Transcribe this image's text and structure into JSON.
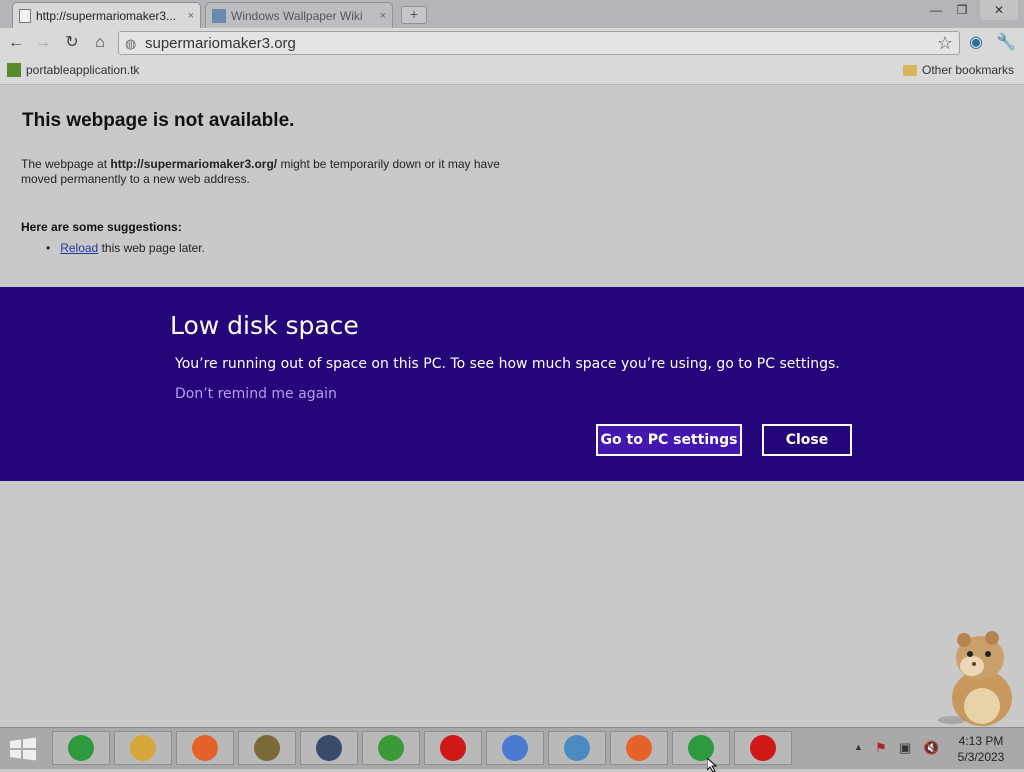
{
  "browser": {
    "tabs": [
      {
        "title": "http://supermariomaker3...",
        "close": "×"
      },
      {
        "title": "Windows Wallpaper Wiki",
        "close": "×"
      }
    ],
    "new_tab": "+",
    "url": "supermariomaker3.org",
    "bookmarks": [
      {
        "label": "portableapplication.tk"
      }
    ],
    "other_bookmarks": "Other bookmarks"
  },
  "error_page": {
    "title": "This webpage is not available.",
    "text_prefix": "The webpage at ",
    "text_url": "http://supermariomaker3.org/",
    "text_suffix": " might be temporarily down or it may have moved permanently to a new web address.",
    "suggestions_title": "Here are some suggestions:",
    "suggestion_link": "Reload",
    "suggestion_rest": " this web page later."
  },
  "dialog": {
    "title": "Low disk space",
    "message": "You’re running out of space on this PC. To see how much space you’re using, go to PC settings.",
    "link": "Don’t remind me again",
    "primary_button": "Go to PC settings",
    "secondary_button": "Close",
    "background_color": "#25067a",
    "accent_color": "#4416b0"
  },
  "taskbar": {
    "apps": [
      {
        "name": "chrome-icon",
        "color": "#2e9a3f"
      },
      {
        "name": "file-explorer-icon",
        "color": "#d6a83b"
      },
      {
        "name": "firefox-icon",
        "color": "#e5622a"
      },
      {
        "name": "boxshot-icon",
        "color": "#7a6a3a"
      },
      {
        "name": "search-magnifier-icon",
        "color": "#3a4a6a"
      },
      {
        "name": "pixel-character-icon",
        "color": "#3a9a3a"
      },
      {
        "name": "opera-icon",
        "color": "#d01818"
      },
      {
        "name": "safari-icon",
        "color": "#4a7ad0"
      },
      {
        "name": "control-panel-icon",
        "color": "#4a8ac0"
      },
      {
        "name": "firefox-icon",
        "color": "#e5622a"
      },
      {
        "name": "chrome-icon",
        "color": "#2e9a3f"
      },
      {
        "name": "opera-icon",
        "color": "#d01818"
      }
    ],
    "time": "4:13 PM",
    "date": "5/3/2023"
  }
}
